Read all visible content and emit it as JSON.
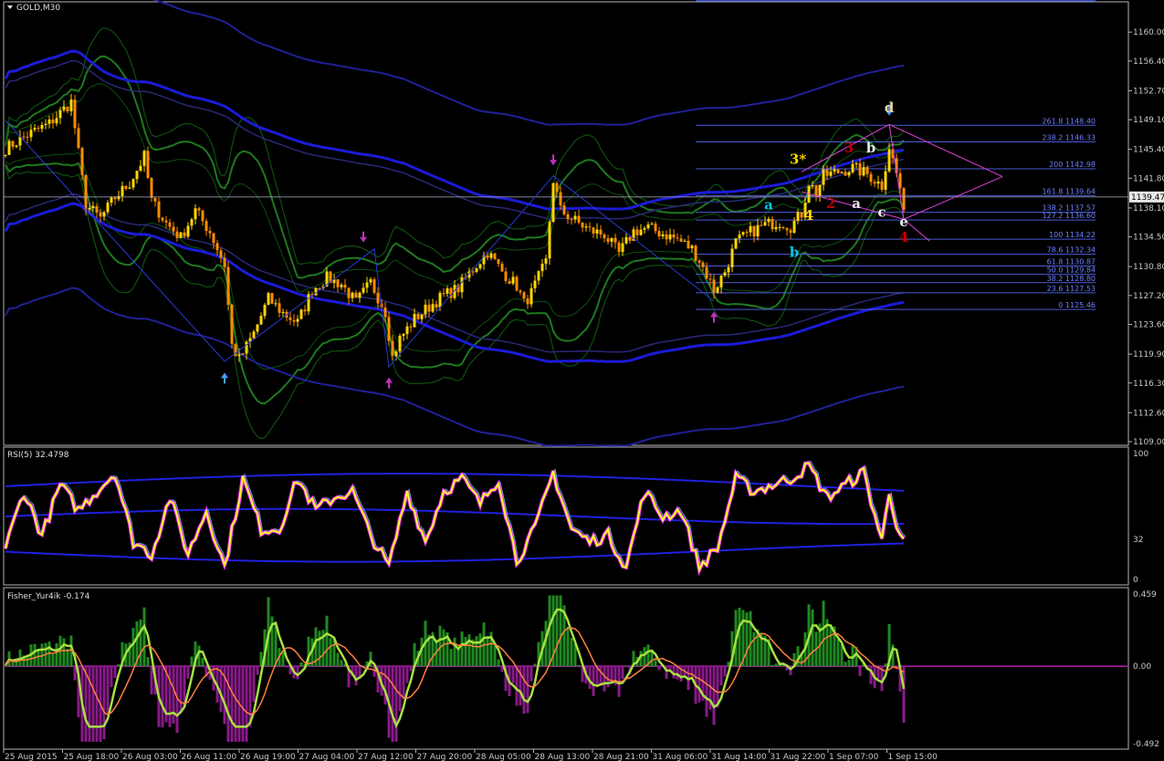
{
  "chart_data": [
    {
      "type": "candlestick",
      "title": "GOLD,M30",
      "symbol": "GOLD",
      "timeframe": "M30",
      "current_price": "1139.47",
      "ylim": [
        1109.0,
        1161.5
      ],
      "y_ticks": [
        "1160.00",
        "1156.40",
        "1152.70",
        "1149.10",
        "1145.40",
        "1141.80",
        "1138.10",
        "1134.50",
        "1130.80",
        "1127.20",
        "1123.60",
        "1119.90",
        "1116.30",
        "1112.60",
        "1109.00"
      ],
      "x_ticks": [
        "25 Aug 2015",
        "25 Aug 18:00",
        "26 Aug 03:00",
        "26 Aug 11:00",
        "26 Aug 19:00",
        "27 Aug 04:00",
        "27 Aug 12:00",
        "27 Aug 20:00",
        "28 Aug 05:00",
        "28 Aug 13:00",
        "28 Aug 21:00",
        "31 Aug 06:00",
        "31 Aug 14:00",
        "31 Aug 22:00",
        "1 Sep 07:00",
        "1 Sep 15:00"
      ],
      "close_path": [
        [
          0,
          1145.5
        ],
        [
          6,
          1147.2
        ],
        [
          12,
          1148.6
        ],
        [
          18,
          1151.3
        ],
        [
          22,
          1138.5
        ],
        [
          26,
          1136.8
        ],
        [
          30,
          1139.4
        ],
        [
          34,
          1141.2
        ],
        [
          38,
          1144.5
        ],
        [
          40,
          1139.0
        ],
        [
          44,
          1136.2
        ],
        [
          48,
          1134.4
        ],
        [
          52,
          1137.8
        ],
        [
          56,
          1135.1
        ],
        [
          60,
          1131.0
        ],
        [
          62,
          1121.0
        ],
        [
          64,
          1119.2
        ],
        [
          68,
          1122.5
        ],
        [
          72,
          1126.8
        ],
        [
          76,
          1125.0
        ],
        [
          80,
          1123.8
        ],
        [
          84,
          1127.9
        ],
        [
          88,
          1129.4
        ],
        [
          92,
          1128.6
        ],
        [
          96,
          1126.3
        ],
        [
          100,
          1128.8
        ],
        [
          104,
          1125.2
        ],
        [
          106,
          1119.5
        ],
        [
          108,
          1121.8
        ],
        [
          112,
          1124.3
        ],
        [
          116,
          1125.8
        ],
        [
          120,
          1127.2
        ],
        [
          124,
          1128.1
        ],
        [
          128,
          1130.5
        ],
        [
          132,
          1132.6
        ],
        [
          136,
          1130.2
        ],
        [
          140,
          1128.4
        ],
        [
          142,
          1126.2
        ],
        [
          144,
          1127.5
        ],
        [
          148,
          1131.4
        ],
        [
          150,
          1141.6
        ],
        [
          152,
          1137.8
        ],
        [
          156,
          1136.5
        ],
        [
          160,
          1135.3
        ],
        [
          164,
          1134.8
        ],
        [
          168,
          1132.4
        ],
        [
          172,
          1135.2
        ],
        [
          176,
          1135.6
        ],
        [
          180,
          1134.9
        ],
        [
          184,
          1134.2
        ],
        [
          188,
          1133.0
        ],
        [
          190,
          1131.6
        ],
        [
          194,
          1127.9
        ],
        [
          197,
          1130.2
        ],
        [
          200,
          1133.8
        ],
        [
          204,
          1135.1
        ],
        [
          208,
          1136.0
        ],
        [
          212,
          1136.4
        ],
        [
          215,
          1135.8
        ],
        [
          218,
          1137.4
        ],
        [
          220,
          1141.3
        ],
        [
          222,
          1140.0
        ],
        [
          224,
          1142.1
        ],
        [
          228,
          1142.6
        ],
        [
          232,
          1143.1
        ],
        [
          236,
          1142.3
        ],
        [
          240,
          1140.9
        ],
        [
          242,
          1145.8
        ],
        [
          245,
          1140.6
        ],
        [
          246,
          1137.1
        ]
      ],
      "fibonacci": [
        {
          "level": "261.8",
          "price": 1148.4
        },
        {
          "level": "238.2",
          "price": 1146.33
        },
        {
          "level": "200",
          "price": 1142.98
        },
        {
          "level": "161.8",
          "price": 1139.64
        },
        {
          "level": "138.2",
          "price": 1137.57
        },
        {
          "level": "127.2",
          "price": 1136.6
        },
        {
          "level": "100",
          "price": 1134.22
        },
        {
          "level": "78.6",
          "price": 1132.34
        },
        {
          "level": "61.8",
          "price": 1130.87
        },
        {
          "level": "50.0",
          "price": 1129.84
        },
        {
          "level": "38.2",
          "price": 1128.8
        },
        {
          "level": "23.6",
          "price": 1127.53
        },
        {
          "level": "0",
          "price": 1125.46
        }
      ],
      "wave_labels": [
        {
          "text": "3*",
          "color": "#ffd700",
          "i": 217,
          "price": 1143.6
        },
        {
          "text": "4",
          "color": "#ffd700",
          "i": 220,
          "price": 1136.6
        },
        {
          "text": "a",
          "color": "#00c8e0",
          "i": 209,
          "price": 1137.9
        },
        {
          "text": "b",
          "color": "#00c8e0",
          "i": 216,
          "price": 1132.0
        },
        {
          "text": "3",
          "color": "#c00000",
          "i": 231,
          "price": 1145.0
        },
        {
          "text": "2",
          "color": "#c00000",
          "i": 226,
          "price": 1138.1
        },
        {
          "text": "a",
          "color": "#e8e8e8",
          "i": 233,
          "price": 1138.1
        },
        {
          "text": "b",
          "color": "#e8e8e8",
          "i": 237,
          "price": 1145.0
        },
        {
          "text": "c",
          "color": "#e8e8e8",
          "i": 240,
          "price": 1137.0
        },
        {
          "text": "d",
          "color": "#f0d7a0",
          "i": 242,
          "price": 1150.0
        },
        {
          "text": "e",
          "color": "#e8e8e8",
          "i": 246,
          "price": 1135.8
        },
        {
          "text": "4",
          "color": "#c00000",
          "i": 246,
          "price": 1133.9
        }
      ]
    },
    {
      "type": "line",
      "title": "RSI(5) 32.4798",
      "ylim": [
        0,
        100
      ],
      "y_ticks": [
        "100",
        "32",
        "0"
      ],
      "rsi_path": [
        [
          0,
          25
        ],
        [
          5,
          70
        ],
        [
          10,
          35
        ],
        [
          15,
          75
        ],
        [
          20,
          55
        ],
        [
          25,
          70
        ],
        [
          30,
          85
        ],
        [
          35,
          30
        ],
        [
          40,
          20
        ],
        [
          45,
          65
        ],
        [
          50,
          20
        ],
        [
          55,
          55
        ],
        [
          60,
          10
        ],
        [
          65,
          80
        ],
        [
          70,
          40
        ],
        [
          75,
          40
        ],
        [
          80,
          80
        ],
        [
          85,
          55
        ],
        [
          90,
          65
        ],
        [
          95,
          70
        ],
        [
          100,
          35
        ],
        [
          105,
          10
        ],
        [
          110,
          70
        ],
        [
          115,
          30
        ],
        [
          120,
          70
        ],
        [
          125,
          80
        ],
        [
          130,
          60
        ],
        [
          135,
          80
        ],
        [
          140,
          15
        ],
        [
          145,
          40
        ],
        [
          150,
          85
        ],
        [
          155,
          40
        ],
        [
          160,
          30
        ],
        [
          165,
          35
        ],
        [
          170,
          10
        ],
        [
          175,
          70
        ],
        [
          180,
          50
        ],
        [
          185,
          55
        ],
        [
          190,
          10
        ],
        [
          195,
          25
        ],
        [
          200,
          80
        ],
        [
          205,
          70
        ],
        [
          210,
          75
        ],
        [
          215,
          80
        ],
        [
          220,
          90
        ],
        [
          225,
          65
        ],
        [
          230,
          75
        ],
        [
          235,
          85
        ],
        [
          240,
          30
        ],
        [
          242,
          70
        ],
        [
          244,
          45
        ],
        [
          246,
          28
        ]
      ]
    },
    {
      "type": "bar",
      "title": "Fisher_Yur4ik -0.174",
      "ylim": [
        -0.492,
        0.459
      ],
      "y_ticks": [
        "0.459",
        "0.00",
        "-0.492"
      ]
    }
  ]
}
